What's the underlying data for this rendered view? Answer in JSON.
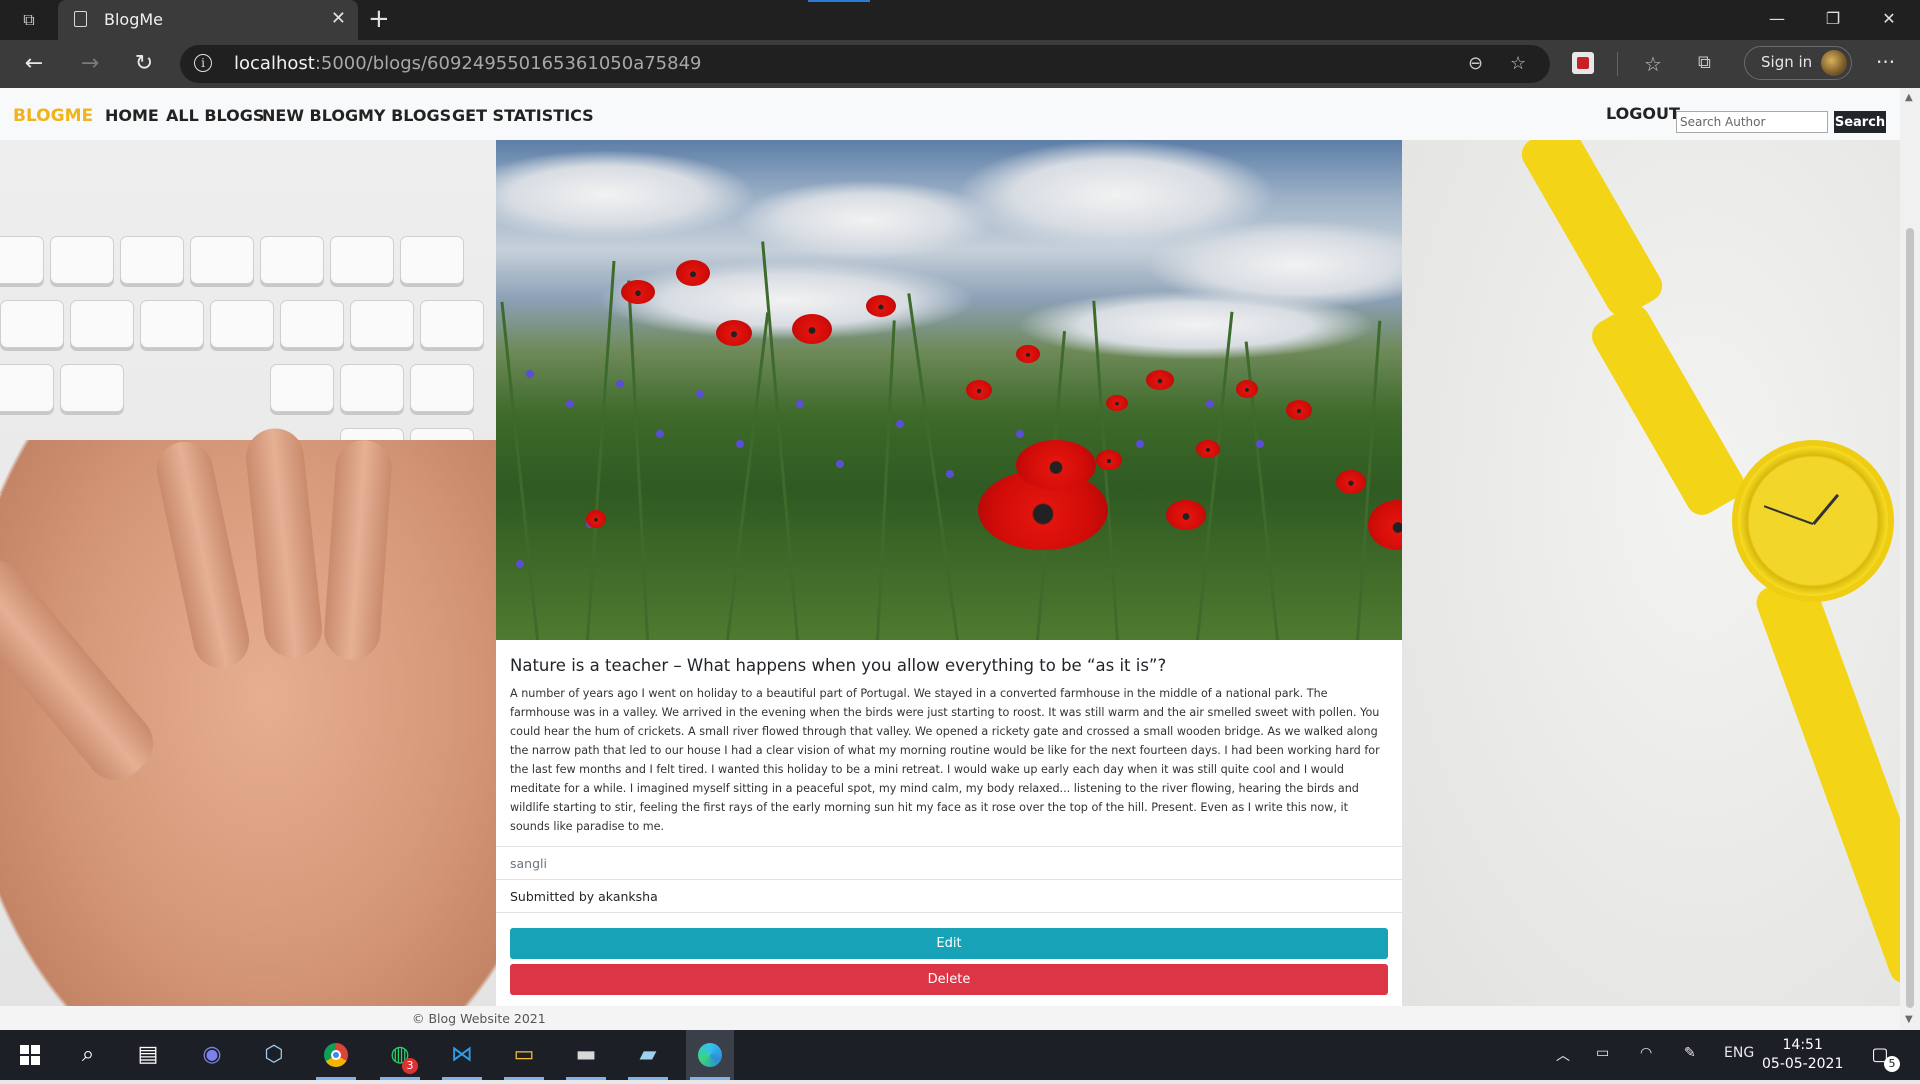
{
  "browser": {
    "tab_title": "BlogMe",
    "url_host": "localhost",
    "url_path": ":5000/blogs/609249550165361050a75849",
    "signin_label": "Sign in"
  },
  "site": {
    "brand": "BLOGME",
    "nav": [
      "HOME",
      "ALL BLOGS",
      "NEW BLOG",
      "MY BLOGS",
      "GET STATISTICS"
    ],
    "logout": "LOGOUT",
    "search_placeholder": "Search Author",
    "search_button": "Search"
  },
  "blog": {
    "title": "Nature is a teacher – What happens when you allow everything to be “as it is”?",
    "body": "A number of years ago I went on holiday to a beautiful part of Portugal. We stayed in a converted farmhouse in the middle of a national park. The farmhouse was in a valley. We arrived in the evening when the birds were just starting to roost. It was still warm and the air smelled sweet with pollen. You could hear the hum of crickets. A small river flowed through that valley. We opened a rickety gate and crossed a small wooden bridge. As we walked along the narrow path that led to our house I had a clear vision of what my morning routine would be like for the next fourteen days. I had been working hard for the last few months and I felt tired. I wanted this holiday to be a mini retreat. I would wake up early each day when it was still quite cool and I would meditate for a while. I imagined myself sitting in a peaceful spot, my mind calm, my body relaxed... listening to the river flowing, hearing the birds and wildlife starting to stir, feeling the first rays of the early morning sun hit my face as it rose over the top of the hill. Present. Even as I write this now, it sounds like paradise to me.",
    "location": "sangli",
    "submitted_by": "Submitted by akanksha",
    "edit_label": "Edit",
    "delete_label": "Delete"
  },
  "footer": "© Blog Website 2021",
  "taskbar": {
    "whatsapp_badge": "3",
    "language": "ENG",
    "time": "14:51",
    "date": "05-05-2021",
    "notification_count": "5"
  },
  "colors": {
    "brand": "#f0b41a",
    "edit": "#17a2b8",
    "delete": "#dc3545"
  }
}
